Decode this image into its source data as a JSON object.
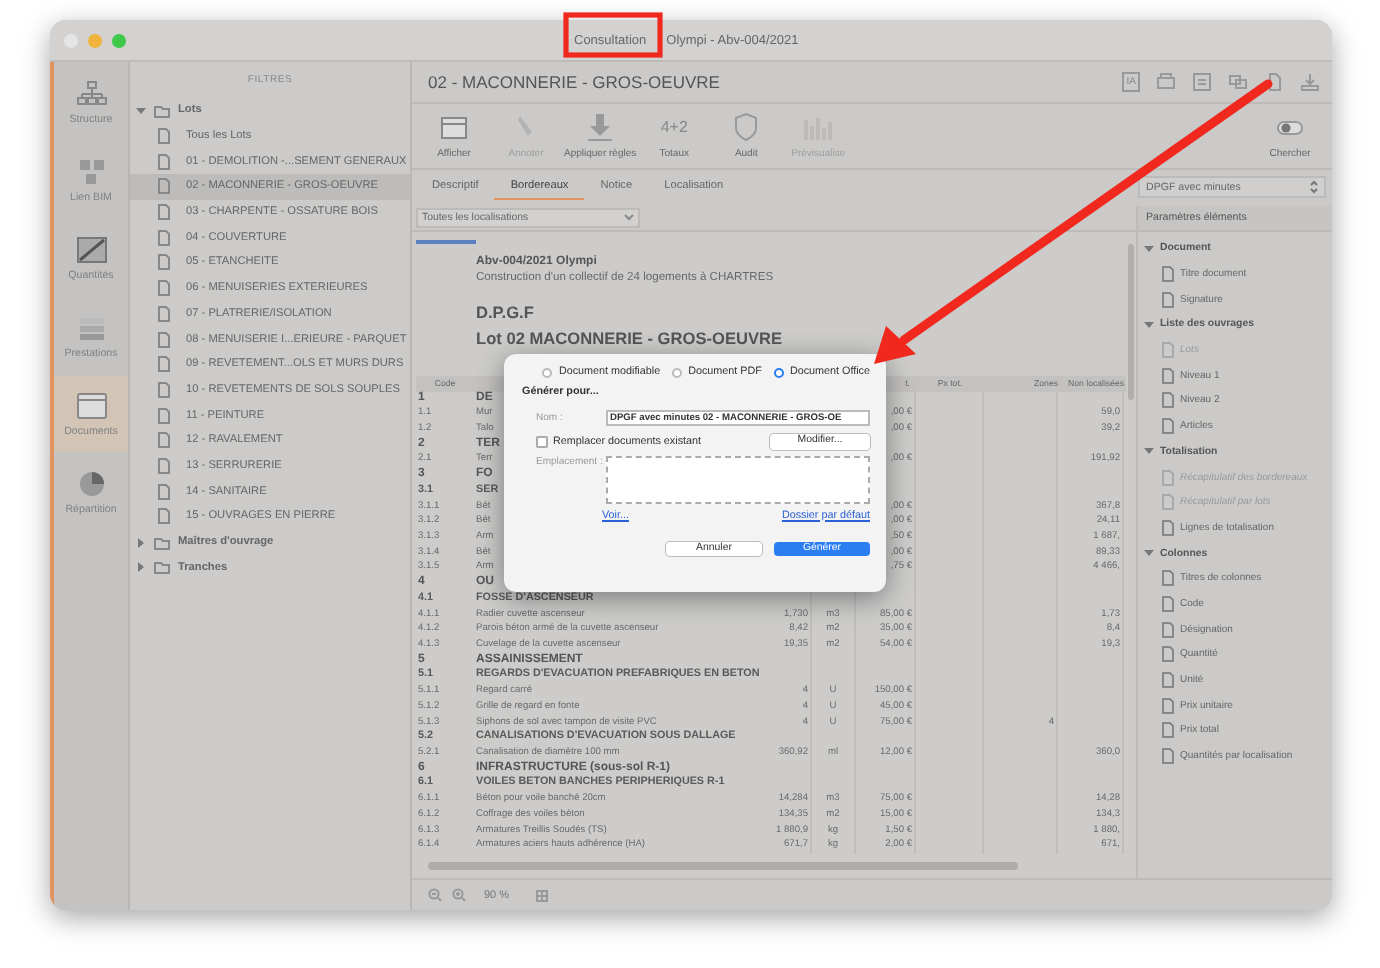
{
  "window": {
    "mode": "Consultation",
    "title": "Olympi - Abv-004/2021"
  },
  "nav": [
    {
      "label": "Structure",
      "selected": false
    },
    {
      "label": "Lien BIM",
      "selected": false
    },
    {
      "label": "Quantités",
      "selected": false
    },
    {
      "label": "Prestations",
      "selected": false
    },
    {
      "label": "Documents",
      "selected": true
    },
    {
      "label": "Répartition",
      "selected": false
    }
  ],
  "filters": {
    "title": "FILTRES",
    "tree": [
      {
        "label": "Lots",
        "expanded": true,
        "children": [
          {
            "label": "Tous les Lots",
            "selected": false
          },
          {
            "label": "01 - DEMOLITION -...SEMENT GENERAUX",
            "selected": false
          },
          {
            "label": "02 - MACONNERIE - GROS-OEUVRE",
            "selected": true
          },
          {
            "label": "03 - CHARPENTE - OSSATURE BOIS",
            "selected": false
          },
          {
            "label": "04 - COUVERTURE",
            "selected": false
          },
          {
            "label": "05 - ETANCHEITE",
            "selected": false
          },
          {
            "label": "06 - MENUISERIES EXTERIEURES",
            "selected": false
          },
          {
            "label": "07 - PLATRERIE/ISOLATION",
            "selected": false
          },
          {
            "label": "08 - MENUISERIE I...ERIEURE - PARQUET",
            "selected": false
          },
          {
            "label": "09 - REVETEMENT...OLS ET MURS DURS",
            "selected": false
          },
          {
            "label": "10 - REVETEMENTS DE SOLS SOUPLES",
            "selected": false
          },
          {
            "label": "11 - PEINTURE",
            "selected": false
          },
          {
            "label": "12 - RAVALEMENT",
            "selected": false
          },
          {
            "label": "13 - SERRURERIE",
            "selected": false
          },
          {
            "label": "14 - SANITAIRE",
            "selected": false
          },
          {
            "label": "15 - OUVRAGES EN PIERRE",
            "selected": false
          }
        ]
      },
      {
        "label": "Maîtres d'ouvrage",
        "expanded": false
      },
      {
        "label": "Tranches",
        "expanded": false
      }
    ]
  },
  "header": {
    "title": "02 - MACONNERIE - GROS-OEUVRE",
    "ia_label": "IA"
  },
  "toolbar": [
    {
      "label": "Afficher",
      "disabled": false
    },
    {
      "label": "Annoter",
      "disabled": true
    },
    {
      "label": "Appliquer règles",
      "disabled": false
    },
    {
      "label": "Totaux",
      "glyph": "4+2",
      "disabled": false
    },
    {
      "label": "Audit",
      "disabled": false
    },
    {
      "label": "Prévisualise",
      "disabled": true
    }
  ],
  "search_button": {
    "label": "Chercher"
  },
  "tabs": [
    {
      "label": "Descriptif",
      "selected": false
    },
    {
      "label": "Bordereaux",
      "selected": true
    },
    {
      "label": "Notice",
      "selected": false
    },
    {
      "label": "Localisation",
      "selected": false
    }
  ],
  "location_filter": {
    "value": "Toutes les localisations"
  },
  "style_select": {
    "value": "DPGF avec minutes"
  },
  "document": {
    "project": "Abv-004/2021 Olympi",
    "description": "Construction d'un collectif de 24 logements à CHARTRES",
    "doc_type": "D.P.G.F",
    "lot": "Lot 02 MACONNERIE - GROS-OEUVRE",
    "columns": [
      {
        "label": "Code"
      },
      {},
      {},
      {},
      {
        "label": "t."
      },
      {
        "label": "Px tot."
      },
      {
        "label": "Zones"
      },
      {
        "label": "Non localisées"
      }
    ],
    "rows": [
      {
        "kind": "chapter",
        "code": "1",
        "designation": "DE"
      },
      {
        "kind": "item",
        "code": "1.1",
        "designation": "Mur",
        "unit_price": ",00 €",
        "non_localised": "59,0"
      },
      {
        "kind": "item",
        "code": "1.2",
        "designation": "Talo",
        "unit_price": ",00 €",
        "non_localised": "39,2"
      },
      {
        "kind": "chapter",
        "code": "2",
        "designation": "TER"
      },
      {
        "kind": "item",
        "code": "2.1",
        "designation": "Terr",
        "unit_price": ",00 €",
        "non_localised": "191,92"
      },
      {
        "kind": "chapter",
        "code": "3",
        "designation": "FO"
      },
      {
        "kind": "section",
        "code": "3.1",
        "designation": "SER"
      },
      {
        "kind": "item",
        "code": "3.1.1",
        "designation": "Bét",
        "unit_price": ",00 €",
        "non_localised": "367,8"
      },
      {
        "kind": "item",
        "code": "3.1.2",
        "designation": "Bét",
        "unit_price": ",00 €",
        "non_localised": "24,11"
      },
      {
        "kind": "item",
        "code": "3.1.3",
        "designation": "Arm",
        "unit_price": ",50 €",
        "non_localised": "1 687,"
      },
      {
        "kind": "item",
        "code": "3.1.4",
        "designation": "Bét",
        "unit_price": ",00 €",
        "non_localised": "89,33"
      },
      {
        "kind": "item",
        "code": "3.1.5",
        "designation": "Arm",
        "unit_price": ",75 €",
        "non_localised": "4 466,"
      },
      {
        "kind": "chapter",
        "code": "4",
        "designation": "OU"
      },
      {
        "kind": "section",
        "code": "4.1",
        "designation": "FOSSE D'ASCENSEUR"
      },
      {
        "kind": "item",
        "code": "4.1.1",
        "designation": "Radier cuvette ascenseur",
        "quantity": "1,730",
        "unit": "m3",
        "unit_price": "85,00 €",
        "non_localised": "1,73"
      },
      {
        "kind": "item",
        "code": "4.1.2",
        "designation": "Parois béton armé de la cuvette ascenseur",
        "quantity": "8,42",
        "unit": "m2",
        "unit_price": "35,00 €",
        "non_localised": "8,4"
      },
      {
        "kind": "item",
        "code": "4.1.3",
        "designation": "Cuvelage de la cuvette ascenseur",
        "quantity": "19,35",
        "unit": "m2",
        "unit_price": "54,00 €",
        "non_localised": "19,3"
      },
      {
        "kind": "chapter",
        "code": "5",
        "designation": "ASSAINISSEMENT"
      },
      {
        "kind": "section",
        "code": "5.1",
        "designation": "REGARDS D'EVACUATION PREFABRIQUES EN BETON"
      },
      {
        "kind": "item",
        "code": "5.1.1",
        "designation": "Regard carré",
        "quantity": "4",
        "unit": "U",
        "unit_price": "150,00 €"
      },
      {
        "kind": "item",
        "code": "5.1.2",
        "designation": "Grille de regard en fonte",
        "quantity": "4",
        "unit": "U",
        "unit_price": "45,00 €"
      },
      {
        "kind": "item",
        "code": "5.1.3",
        "designation": "Siphons de sol avec tampon de visite PVC",
        "quantity": "4",
        "unit": "U",
        "unit_price": "75,00 €",
        "zones": "4"
      },
      {
        "kind": "section",
        "code": "5.2",
        "designation": "CANALISATIONS D'EVACUATION SOUS DALLAGE"
      },
      {
        "kind": "item",
        "code": "5.2.1",
        "designation": "Canalisation de diamètre 100 mm",
        "quantity": "360,92",
        "unit": "ml",
        "unit_price": "12,00 €",
        "non_localised": "360,0"
      },
      {
        "kind": "chapter",
        "code": "6",
        "designation": "INFRASTRUCTURE (sous-sol R-1)"
      },
      {
        "kind": "section",
        "code": "6.1",
        "designation": "VOILES BETON BANCHES PERIPHERIQUES R-1"
      },
      {
        "kind": "item",
        "code": "6.1.1",
        "designation": "Béton pour voile banché 20cm",
        "quantity": "14,284",
        "unit": "m3",
        "unit_price": "75,00 €",
        "non_localised": "14,28"
      },
      {
        "kind": "item",
        "code": "6.1.2",
        "designation": "Coffrage des voiles béton",
        "quantity": "134,35",
        "unit": "m2",
        "unit_price": "15,00 €",
        "non_localised": "134,3"
      },
      {
        "kind": "item",
        "code": "6.1.3",
        "designation": "Armatures Treillis Soudés (TS)",
        "quantity": "1 880,9",
        "unit": "kg",
        "unit_price": "1,50 €",
        "non_localised": "1 880,"
      },
      {
        "kind": "item",
        "code": "6.1.4",
        "designation": "Armatures aciers hauts adhérence (HA)",
        "quantity": "671,7",
        "unit": "kg",
        "unit_price": "2,00 €",
        "non_localised": "671,"
      }
    ]
  },
  "params": {
    "title": "Paramètres éléments",
    "sections": [
      {
        "label": "Document",
        "expanded": true,
        "children": [
          {
            "label": "Titre document",
            "disabled": false
          },
          {
            "label": "Signature",
            "disabled": false
          }
        ]
      },
      {
        "label": "Liste des ouvrages",
        "expanded": true,
        "children": [
          {
            "label": "Lots",
            "disabled": true
          },
          {
            "label": "Niveau 1",
            "disabled": false
          },
          {
            "label": "Niveau 2",
            "disabled": false
          },
          {
            "label": "Articles",
            "disabled": false
          }
        ]
      },
      {
        "label": "Totalisation",
        "expanded": true,
        "children": [
          {
            "label": "Récapitulatif des bordereaux",
            "disabled": true
          },
          {
            "label": "Récapitulatif par lots",
            "disabled": true
          },
          {
            "label": "Lignes de totalisation",
            "disabled": false
          }
        ]
      },
      {
        "label": "Colonnes",
        "expanded": true,
        "children": [
          {
            "label": "Titres de colonnes",
            "disabled": false
          },
          {
            "label": "Code",
            "disabled": false
          },
          {
            "label": "Désignation",
            "disabled": false
          },
          {
            "label": "Quantité",
            "disabled": false
          },
          {
            "label": "Unité",
            "disabled": false
          },
          {
            "label": "Prix unitaire",
            "disabled": false
          },
          {
            "label": "Prix total",
            "disabled": false
          },
          {
            "label": "Quantités par localisation",
            "disabled": false
          }
        ]
      }
    ]
  },
  "dialog": {
    "formats": [
      {
        "label": "Document modifiable",
        "selected": false
      },
      {
        "label": "Document PDF",
        "selected": false
      },
      {
        "label": "Document Office",
        "selected": true
      }
    ],
    "heading": "Générer pour...",
    "name_label": "Nom :",
    "name_value": "DPGF avec minutes 02 - MACONNERIE - GROS-OE",
    "replace": {
      "label": "Remplacer documents existant",
      "checked": false
    },
    "modify_button": "Modifier...",
    "location_label": "Emplacement :",
    "view_link": "Voir...",
    "default_link": "Dossier par défaut",
    "cancel_button": "Annuler",
    "generate_button": "Générer"
  },
  "status": {
    "zoom": "90 %"
  }
}
